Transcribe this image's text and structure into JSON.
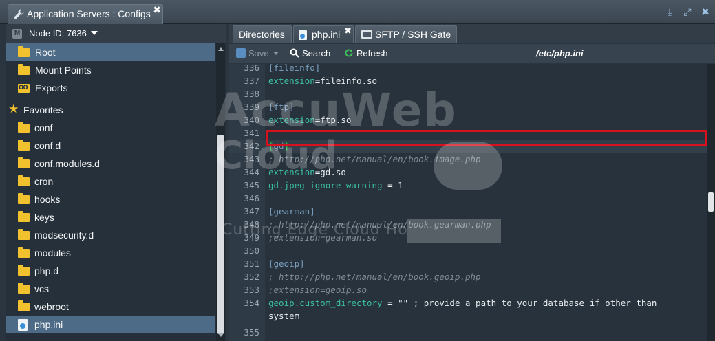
{
  "window": {
    "title": "Application Servers : Configs",
    "close": "✖"
  },
  "left": {
    "node_label": "Node ID: 7636",
    "tree": [
      {
        "label": "Root",
        "icon": "folder-icon",
        "selected": true
      },
      {
        "label": "Mount Points",
        "icon": "folder-icon"
      },
      {
        "label": "Exports",
        "icon": "exports-icon"
      },
      {
        "label": "Favorites",
        "icon": "star-icon"
      },
      {
        "label": "conf",
        "icon": "folder-icon"
      },
      {
        "label": "conf.d",
        "icon": "folder-icon"
      },
      {
        "label": "conf.modules.d",
        "icon": "folder-icon"
      },
      {
        "label": "cron",
        "icon": "folder-icon"
      },
      {
        "label": "hooks",
        "icon": "folder-icon"
      },
      {
        "label": "keys",
        "icon": "folder-icon"
      },
      {
        "label": "modsecurity.d",
        "icon": "folder-icon"
      },
      {
        "label": "modules",
        "icon": "folder-icon"
      },
      {
        "label": "php.d",
        "icon": "folder-icon"
      },
      {
        "label": "vcs",
        "icon": "folder-icon"
      },
      {
        "label": "webroot",
        "icon": "folder-icon"
      },
      {
        "label": "php.ini",
        "icon": "php-file-icon",
        "selected": true
      }
    ]
  },
  "tabs": [
    {
      "label": "Directories"
    },
    {
      "label": "php.ini",
      "active": true,
      "close": "✖"
    },
    {
      "label": "SFTP / SSH Gate"
    }
  ],
  "toolbar": {
    "save_label": "Save",
    "search_label": "Search",
    "refresh_label": "Refresh",
    "path": "/etc/php.ini"
  },
  "editor": {
    "lines": [
      {
        "num": "336",
        "text": "[fileinfo]"
      },
      {
        "num": "337",
        "text": "extension=fileinfo.so"
      },
      {
        "num": "338",
        "text": ""
      },
      {
        "num": "339",
        "text": "[ftp]"
      },
      {
        "num": "340",
        "text": "extension=ftp.so"
      },
      {
        "num": "341",
        "text": ""
      },
      {
        "num": "342",
        "text": "[gd]"
      },
      {
        "num": "343",
        "text": "; http://php.net/manual/en/book.image.php"
      },
      {
        "num": "344",
        "text": "extension=gd.so"
      },
      {
        "num": "345",
        "text": "gd.jpeg_ignore_warning = 1"
      },
      {
        "num": "346",
        "text": ""
      },
      {
        "num": "347",
        "text": "[gearman]"
      },
      {
        "num": "348",
        "text": "; http://php.net/manual/en/book.gearman.php"
      },
      {
        "num": "349",
        "text": ";extension=gearman.so"
      },
      {
        "num": "350",
        "text": ""
      },
      {
        "num": "351",
        "text": "[geoip]"
      },
      {
        "num": "352",
        "text": "; http://php.net/manual/en/book.geoip.php"
      },
      {
        "num": "353",
        "text": ";extension=geoip.so"
      },
      {
        "num": "354",
        "text": "geoip.custom_directory = \"\" ; provide a path to your database if other than"
      },
      {
        "num": "",
        "text": "system"
      },
      {
        "num": "355",
        "text": ""
      }
    ]
  },
  "watermark": {
    "line1": "AccuWeb",
    "line2": "Cloud",
    "tagline": "Cutting Edge Cloud Hosting"
  },
  "colors": {
    "accent": "#4d6b86",
    "highlight_box": "#d8111e",
    "folder": "#f2c12e"
  }
}
